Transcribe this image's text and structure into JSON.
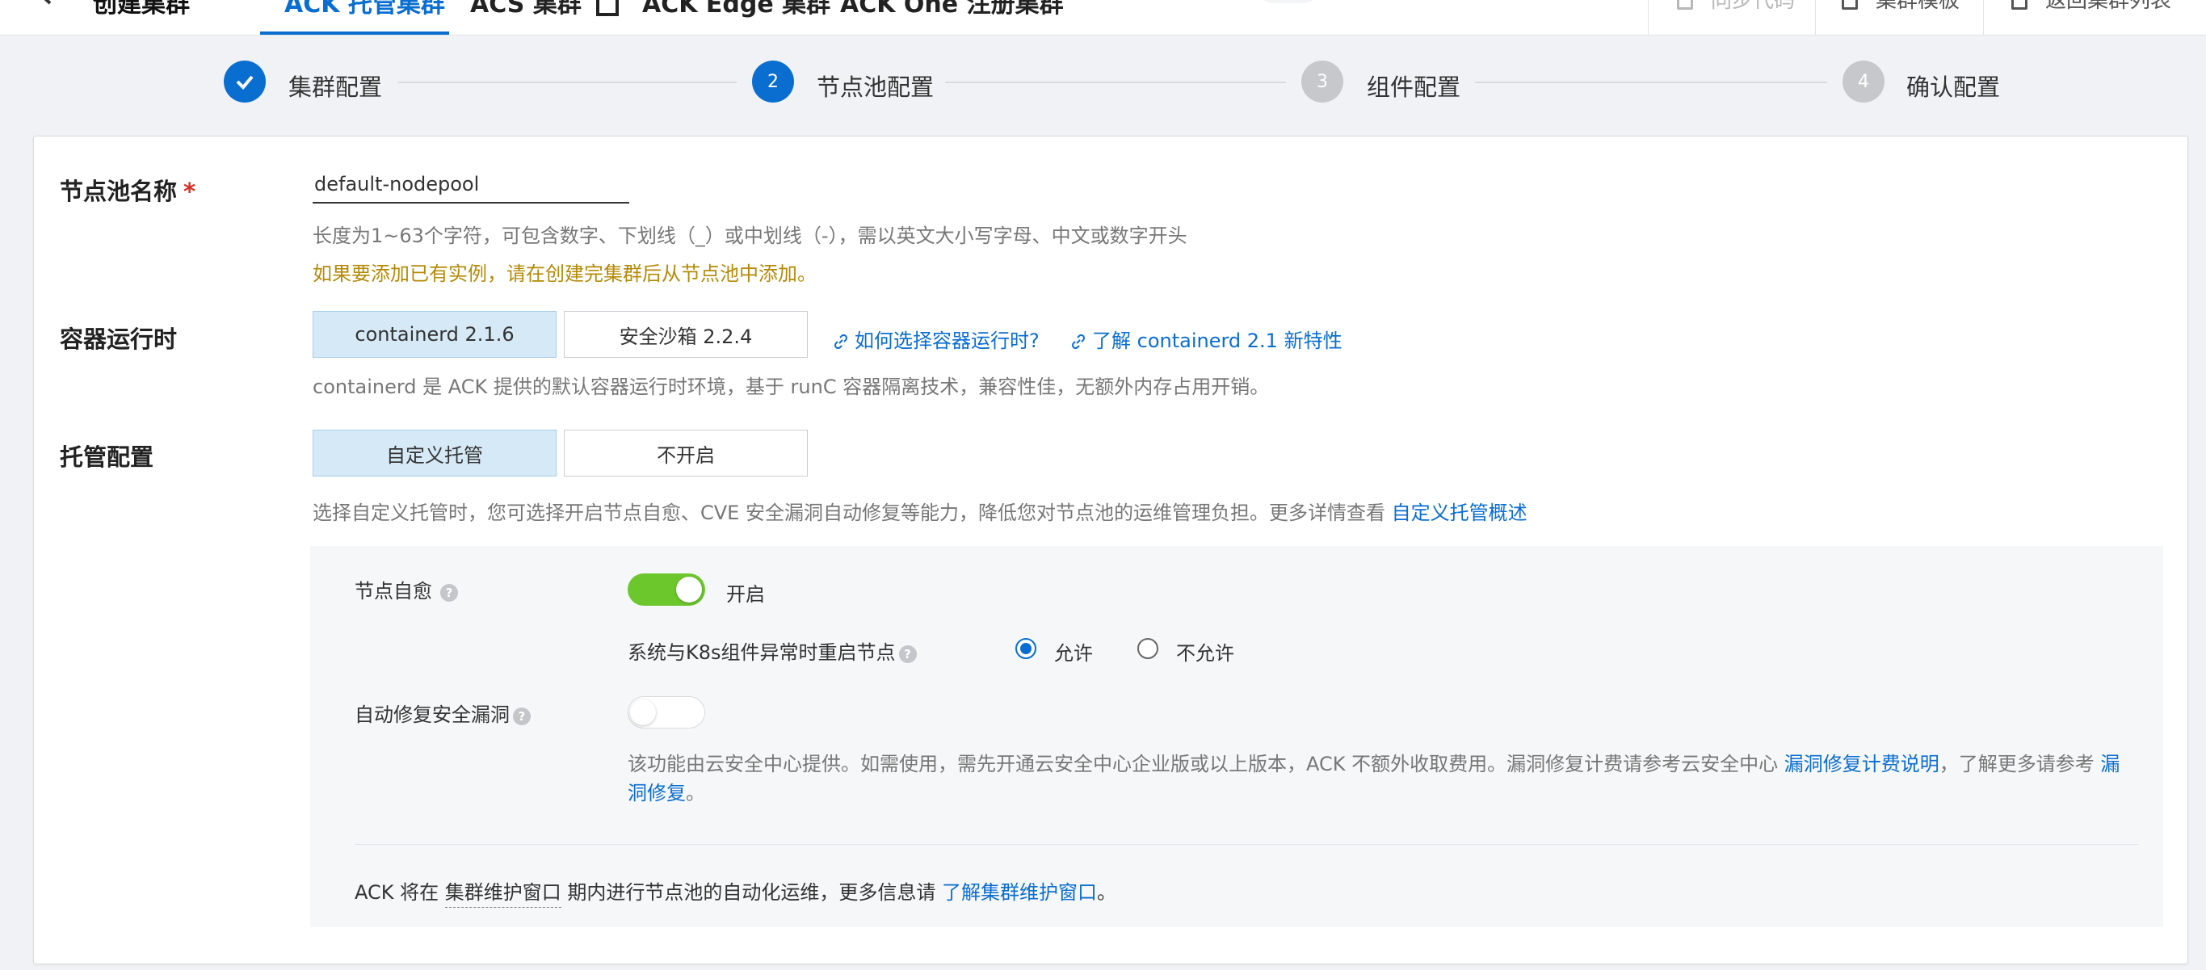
{
  "header": {
    "page_title": "创建集群",
    "tabs": [
      {
        "label": "ACK 托管集群",
        "active": true
      },
      {
        "label": "ACS 集群",
        "external": true
      },
      {
        "label": "ACK Edge 集群"
      },
      {
        "label": "ACK One 注册集群"
      }
    ],
    "actions": [
      {
        "label": "同步代码",
        "disabled": true
      },
      {
        "label": "集群模板"
      },
      {
        "label": "返回集群列表"
      }
    ]
  },
  "steps": [
    {
      "label": "集群配置",
      "state": "done"
    },
    {
      "number": "2",
      "label": "节点池配置",
      "state": "current"
    },
    {
      "number": "3",
      "label": "组件配置",
      "state": "pending"
    },
    {
      "number": "4",
      "label": "确认配置",
      "state": "pending"
    }
  ],
  "form": {
    "nodepool_name": {
      "label": "节点池名称",
      "required_mark": "*",
      "value": "default-nodepool",
      "help": "长度为1~63个字符，可包含数字、下划线（_）或中划线（-），需以英文大小写字母、中文或数字开头",
      "warning": "如果要添加已有实例，请在创建完集群后从节点池中添加。"
    },
    "runtime": {
      "label": "容器运行时",
      "options": [
        {
          "label": "containerd 2.1.6",
          "selected": true
        },
        {
          "label": "安全沙箱 2.2.4",
          "selected": false
        }
      ],
      "links": [
        "如何选择容器运行时?",
        "了解 containerd 2.1 新特性"
      ],
      "help": "containerd 是 ACK 提供的默认容器运行时环境，基于 runC 容器隔离技术，兼容性佳，无额外内存占用开销。"
    },
    "managed": {
      "label": "托管配置",
      "options": [
        {
          "label": "自定义托管",
          "selected": true
        },
        {
          "label": "不开启",
          "selected": false
        }
      ],
      "help_prefix": "选择自定义托管时，您可选择开启节点自愈、CVE 安全漏洞自动修复等能力，降低您对节点池的运维管理负担。更多详情查看 ",
      "help_link": "自定义托管概述",
      "self_heal": {
        "label": "节点自愈",
        "enabled": true,
        "status_text": "开启",
        "restart_label": "系统与K8s组件异常时重启节点",
        "radio_options": [
          {
            "label": "允许",
            "checked": true
          },
          {
            "label": "不允许",
            "checked": false
          }
        ]
      },
      "auto_repair": {
        "label": "自动修复安全漏洞",
        "enabled": false,
        "desc_prefix": "该功能由云安全中心提供。如需使用，需先开通云安全中心企业版或以上版本，ACK 不额外收取费用。漏洞修复计费请参考云安全中心 ",
        "desc_link1": "漏洞修复计费说明",
        "desc_mid": "，了解更多请参考 ",
        "desc_link2": "漏洞修复",
        "desc_suffix": "。"
      },
      "maintenance": {
        "prefix": "ACK 将在 ",
        "term": "集群维护窗口",
        "middle": " 期内进行节点池的自动化运维，更多信息请 ",
        "link": "了解集群维护窗口",
        "suffix": "。"
      }
    }
  },
  "colors": {
    "primary": "#0a6ed1",
    "toggle_on": "#6cc72c",
    "warning_text": "#b58a06",
    "selected_bg": "#d6e9f7"
  }
}
